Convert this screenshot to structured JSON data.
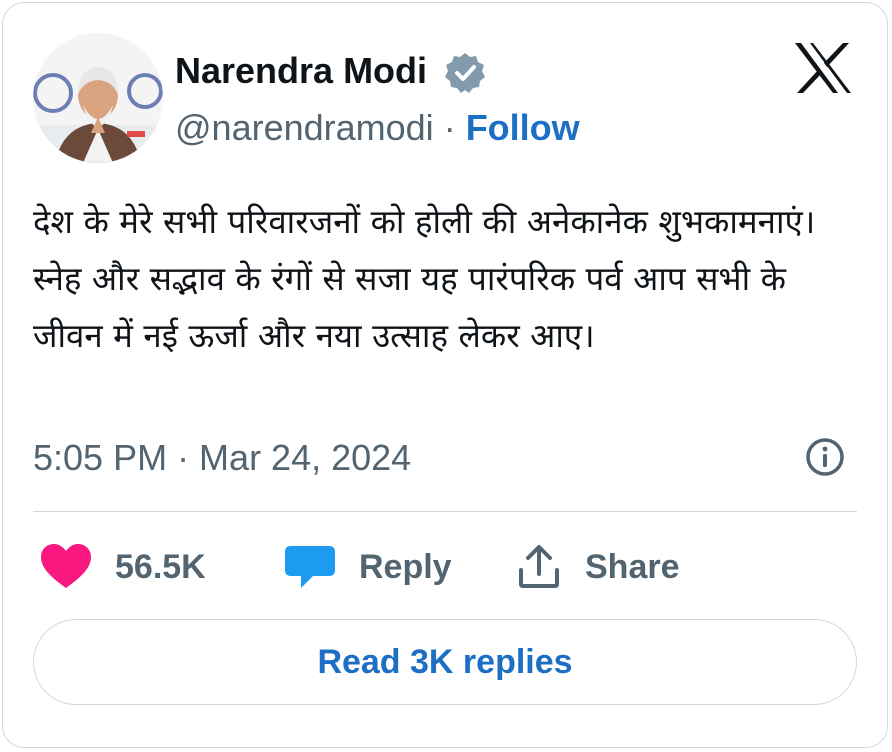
{
  "author": {
    "name": "Narendra Modi",
    "handle": "@narendramodi",
    "separator": "·",
    "follow_label": "Follow",
    "verified_icon": "verified-badge-icon"
  },
  "tweet": {
    "text": "देश के मेरे सभी परिवारजनों को होली की अनेकानेक शुभकामनाएं। स्नेह और सद्भाव के रंगों से सजा यह पारंपरिक पर्व आप सभी के जीवन में नई ऊर्जा और नया उत्साह लेकर आए।",
    "timestamp": "5:05 PM · Mar 24, 2024"
  },
  "actions": {
    "like_count": "56.5K",
    "reply_label": "Reply",
    "share_label": "Share"
  },
  "read_replies_label": "Read 3K replies",
  "colors": {
    "accent": "#1d6fc6",
    "heart": "#f91880",
    "reply_bubble": "#1d9bf0",
    "muted_text": "#536471",
    "border": "#cfd9de"
  }
}
